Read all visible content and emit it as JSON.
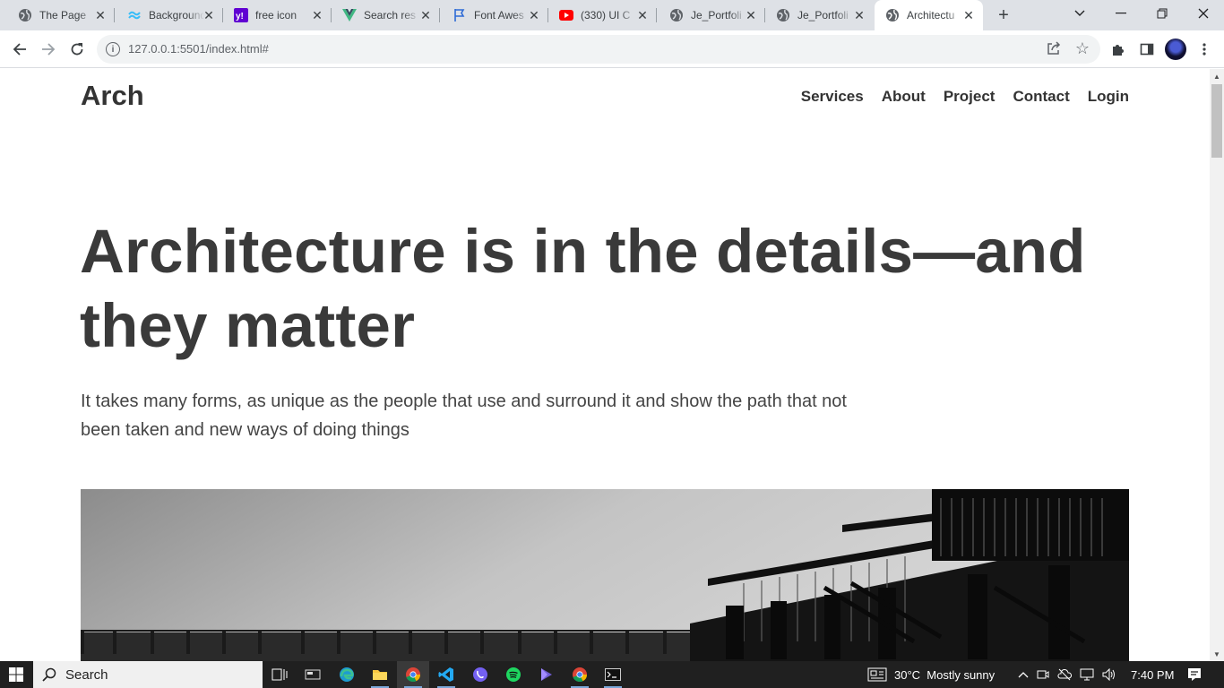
{
  "browser": {
    "tabs": [
      {
        "title": "The Page",
        "icon": "globe-icon"
      },
      {
        "title": "Background",
        "icon": "tailwind-icon"
      },
      {
        "title": "free icon",
        "icon": "yahoo-icon"
      },
      {
        "title": "Search res",
        "icon": "vue-icon"
      },
      {
        "title": "Font Awes",
        "icon": "flag-icon"
      },
      {
        "title": "(330) UI C",
        "icon": "youtube-icon"
      },
      {
        "title": "Je_Portfoli",
        "icon": "globe-icon"
      },
      {
        "title": "Je_Portfoli",
        "icon": "globe-icon"
      },
      {
        "title": "Architectu",
        "icon": "globe-icon",
        "active": true
      }
    ],
    "url": "127.0.0.1:5501/index.html#"
  },
  "site": {
    "logo": "Arch",
    "nav": [
      "Services",
      "About",
      "Project",
      "Contact",
      "Login"
    ],
    "hero": {
      "title": "Architecture is in the details—and they matter",
      "subtitle": "It takes many forms, as unique as the people that use and surround it and show the path that not been taken and new ways of doing things"
    }
  },
  "taskbar": {
    "search_label": "Search",
    "weather": "30°C  Mostly sunny",
    "time": "7:40 PM"
  },
  "colors": {
    "tabstrip": "#dee1e6",
    "text_dark": "#333333",
    "taskbar": "#202020"
  }
}
